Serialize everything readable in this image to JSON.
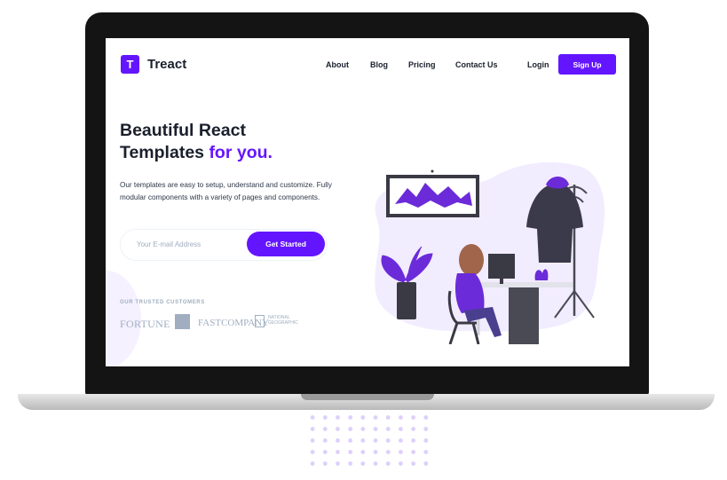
{
  "brand": {
    "logo_letter": "T",
    "name": "Treact"
  },
  "nav": {
    "links": [
      "About",
      "Blog",
      "Pricing",
      "Contact Us"
    ],
    "login": "Login",
    "signup": "Sign Up"
  },
  "hero": {
    "title_line1": "Beautiful React",
    "title_line2_start": "Templates",
    "title_accent": "for you.",
    "description": "Our templates are easy to setup, understand and customize. Fully modular components with a variety of pages and components.",
    "email_placeholder": "Your E-mail Address",
    "cta": "Get Started"
  },
  "customers": {
    "label": "OUR TRUSTED CUSTOMERS",
    "logos": [
      "FORTUNE",
      "FASTCOMPANY",
      "NATIONAL GEOGRAPHIC"
    ]
  },
  "colors": {
    "accent": "#6415ff",
    "text_dark": "#1a202c",
    "muted": "#a0aec0",
    "bezel": "#141414"
  }
}
